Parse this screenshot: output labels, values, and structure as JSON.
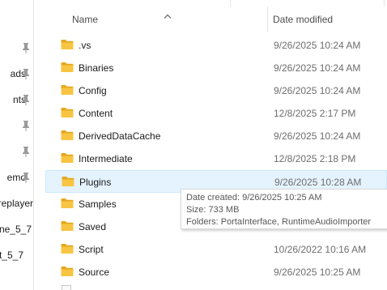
{
  "nav_pane": {
    "items": [
      {
        "label": "",
        "pinned": true
      },
      {
        "label": "ads",
        "pinned": true
      },
      {
        "label": "nts",
        "pinned": true
      },
      {
        "label": "",
        "pinned": true
      },
      {
        "label": "",
        "pinned": true
      },
      {
        "label": "emo",
        "pinned": true
      },
      {
        "label": "replayer",
        "pinned": false
      },
      {
        "label": "ne_5_7",
        "pinned": false
      },
      {
        "label": "t_5_7",
        "pinned": false
      }
    ]
  },
  "columns": {
    "name": "Name",
    "date_modified": "Date modified"
  },
  "files": [
    {
      "name": ".vs",
      "date": "9/26/2025 10:24 AM",
      "type": "folder"
    },
    {
      "name": "Binaries",
      "date": "9/26/2025 10:24 AM",
      "type": "folder"
    },
    {
      "name": "Config",
      "date": "9/26/2025 10:24 AM",
      "type": "folder"
    },
    {
      "name": "Content",
      "date": "12/8/2025 2:17 PM",
      "type": "folder"
    },
    {
      "name": "DerivedDataCache",
      "date": "9/26/2025 10:24 AM",
      "type": "folder"
    },
    {
      "name": "Intermediate",
      "date": "12/8/2025 2:18 PM",
      "type": "folder"
    },
    {
      "name": "Plugins",
      "date": "9/26/2025 10:28 AM",
      "type": "folder",
      "selected": true
    },
    {
      "name": "Samples",
      "date": "",
      "type": "folder"
    },
    {
      "name": "Saved",
      "date": "",
      "type": "folder"
    },
    {
      "name": "Script",
      "date": "10/26/2022 10:16 AM",
      "type": "folder"
    },
    {
      "name": "Source",
      "date": "9/26/2025 10:25 AM",
      "type": "folder"
    }
  ],
  "tooltip": {
    "created": "Date created: 9/26/2025 10:25 AM",
    "size": "Size: 733 MB",
    "folders": "Folders: PortaInterface, RuntimeAudioImporter"
  },
  "colors": {
    "folder": "#f8c542",
    "folder_dark": "#e4a81e",
    "selection": "#e5f3ff",
    "pin": "#9a9a9a"
  },
  "icons": {
    "folder": "folder-icon",
    "pin": "pin-icon",
    "sort": "sort-ascending-icon"
  }
}
